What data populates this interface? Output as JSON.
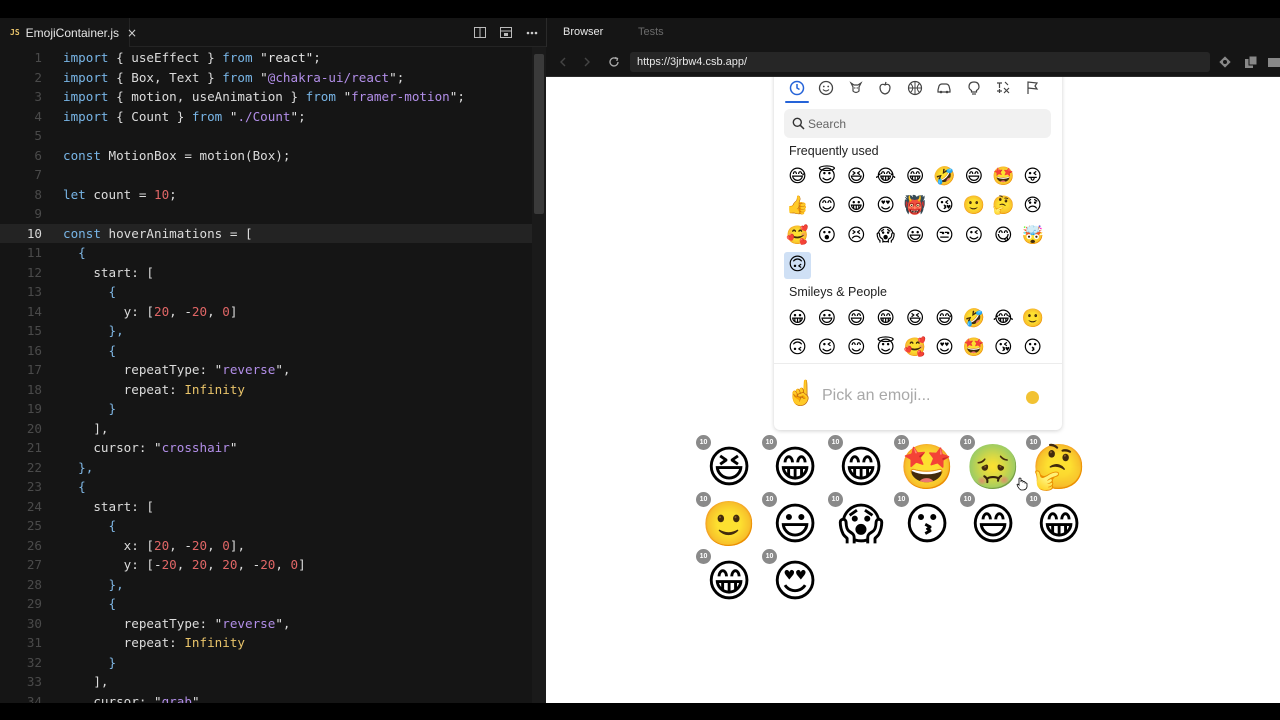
{
  "editor": {
    "tab": {
      "badge": "JS",
      "filename": "EmojiContainer.js",
      "close": "×"
    },
    "active_line": 10,
    "lines": [
      [
        [
          "kw",
          "import"
        ],
        [
          "t",
          " { useEffect } "
        ],
        [
          "kw",
          "from"
        ],
        [
          "t",
          " "
        ],
        [
          "str",
          "\"react\""
        ],
        [
          "t",
          ";"
        ]
      ],
      [
        [
          "kw",
          "import"
        ],
        [
          "t",
          " { Box, Text } "
        ],
        [
          "kw",
          "from"
        ],
        [
          "t",
          " "
        ],
        [
          "str",
          "\""
        ],
        [
          "strv",
          "@chakra-ui/react"
        ],
        [
          "str",
          "\""
        ],
        [
          "t",
          ";"
        ]
      ],
      [
        [
          "kw",
          "import"
        ],
        [
          "t",
          " { motion, useAnimation } "
        ],
        [
          "kw",
          "from"
        ],
        [
          "t",
          " "
        ],
        [
          "str",
          "\""
        ],
        [
          "strv",
          "framer-motion"
        ],
        [
          "str",
          "\""
        ],
        [
          "t",
          ";"
        ]
      ],
      [
        [
          "kw",
          "import"
        ],
        [
          "t",
          " { Count } "
        ],
        [
          "kw",
          "from"
        ],
        [
          "t",
          " "
        ],
        [
          "str",
          "\""
        ],
        [
          "strv",
          "./Count"
        ],
        [
          "str",
          "\""
        ],
        [
          "t",
          ";"
        ]
      ],
      [],
      [
        [
          "kw",
          "const"
        ],
        [
          "t",
          " MotionBox = motion(Box);"
        ]
      ],
      [],
      [
        [
          "kw",
          "let"
        ],
        [
          "t",
          " count = "
        ],
        [
          "num",
          "10"
        ],
        [
          "t",
          ";"
        ]
      ],
      [],
      [
        [
          "kw",
          "const"
        ],
        [
          "t",
          " hoverAnimations = ["
        ]
      ],
      [
        [
          "p",
          "  {"
        ]
      ],
      [
        [
          "t",
          "    start: ["
        ]
      ],
      [
        [
          "p",
          "      {"
        ]
      ],
      [
        [
          "t",
          "        y: ["
        ],
        [
          "num",
          "20"
        ],
        [
          "t",
          ", -"
        ],
        [
          "num",
          "20"
        ],
        [
          "t",
          ", "
        ],
        [
          "num",
          "0"
        ],
        [
          "t",
          "]"
        ]
      ],
      [
        [
          "p",
          "      },"
        ]
      ],
      [
        [
          "p",
          "      {"
        ]
      ],
      [
        [
          "t",
          "        repeatType: "
        ],
        [
          "str",
          "\""
        ],
        [
          "strv",
          "reverse"
        ],
        [
          "str",
          "\""
        ],
        [
          "t",
          ","
        ]
      ],
      [
        [
          "t",
          "        repeat: "
        ],
        [
          "inf",
          "Infinity"
        ]
      ],
      [
        [
          "p",
          "      }"
        ]
      ],
      [
        [
          "t",
          "    ],"
        ]
      ],
      [
        [
          "t",
          "    cursor: "
        ],
        [
          "str",
          "\""
        ],
        [
          "strv",
          "crosshair"
        ],
        [
          "str",
          "\""
        ]
      ],
      [
        [
          "p",
          "  },"
        ]
      ],
      [
        [
          "p",
          "  {"
        ]
      ],
      [
        [
          "t",
          "    start: ["
        ]
      ],
      [
        [
          "p",
          "      {"
        ]
      ],
      [
        [
          "t",
          "        x: ["
        ],
        [
          "num",
          "20"
        ],
        [
          "t",
          ", -"
        ],
        [
          "num",
          "20"
        ],
        [
          "t",
          ", "
        ],
        [
          "num",
          "0"
        ],
        [
          "t",
          "],"
        ]
      ],
      [
        [
          "t",
          "        y: [-"
        ],
        [
          "num",
          "20"
        ],
        [
          "t",
          ", "
        ],
        [
          "num",
          "20"
        ],
        [
          "t",
          ", "
        ],
        [
          "num",
          "20"
        ],
        [
          "t",
          ", -"
        ],
        [
          "num",
          "20"
        ],
        [
          "t",
          ", "
        ],
        [
          "num",
          "0"
        ],
        [
          "t",
          "]"
        ]
      ],
      [
        [
          "p",
          "      },"
        ]
      ],
      [
        [
          "p",
          "      {"
        ]
      ],
      [
        [
          "t",
          "        repeatType: "
        ],
        [
          "str",
          "\""
        ],
        [
          "strv",
          "reverse"
        ],
        [
          "str",
          "\""
        ],
        [
          "t",
          ","
        ]
      ],
      [
        [
          "t",
          "        repeat: "
        ],
        [
          "inf",
          "Infinity"
        ]
      ],
      [
        [
          "p",
          "      }"
        ]
      ],
      [
        [
          "t",
          "    ],"
        ]
      ],
      [
        [
          "t",
          "    cursor: "
        ],
        [
          "str",
          "\""
        ],
        [
          "strv",
          "grab"
        ],
        [
          "str",
          "\""
        ]
      ]
    ]
  },
  "browser": {
    "tabs": [
      "Browser",
      "Tests"
    ],
    "active_tab": "Browser",
    "url": "https://3jrbw4.csb.app/"
  },
  "picker": {
    "search_placeholder": "Search",
    "sections": [
      {
        "title": "Frequently used",
        "emojis": [
          "😅",
          "😇",
          "😆",
          "😂",
          "😁",
          "🤣",
          "😄",
          "🤩",
          "😜",
          "👍",
          "😊",
          "😀",
          "😍",
          "👹",
          "😘",
          "🙂",
          "🤔",
          "😞",
          "🥰",
          "😮",
          "😣",
          "😱",
          "😃",
          "😒",
          "😉",
          "😋",
          "🤯",
          "🙃"
        ]
      },
      {
        "title": "Smileys & People",
        "emojis": [
          "😀",
          "😃",
          "😄",
          "😁",
          "😆",
          "😅",
          "🤣",
          "😂",
          "🙂",
          "🙃",
          "😉",
          "😊",
          "😇",
          "🥰",
          "😍",
          "🤩",
          "😘",
          "😗"
        ]
      }
    ],
    "highlighted_index": 27,
    "footer": {
      "preview_emoji": "☝️",
      "placeholder": "Pick an emoji..."
    }
  },
  "grid": {
    "badge": "10",
    "emojis": [
      "😆",
      "😁",
      "😁",
      "🤩",
      "🤢",
      "🤔",
      "🙂",
      "😃",
      "😱",
      "😗",
      "😄",
      "😁",
      "😁",
      "😍"
    ]
  }
}
